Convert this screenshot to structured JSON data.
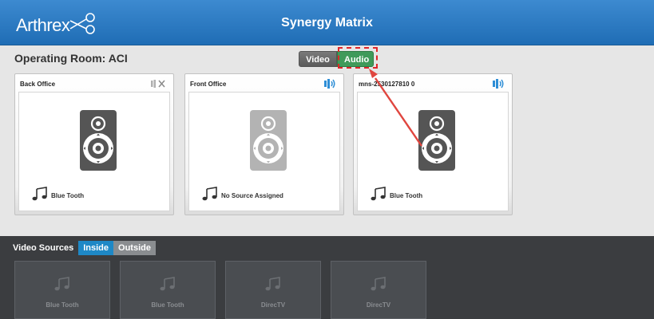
{
  "header": {
    "logo_text": "Arthrex",
    "app_title": "Synergy Matrix"
  },
  "room": {
    "title": "Operating Room: ACI"
  },
  "mode_toggle": {
    "video_label": "Video",
    "audio_label": "Audio",
    "selected": "Audio"
  },
  "zones": [
    {
      "name": "Back Office",
      "volume_icon": "speaker-muted-icon",
      "source": "Blue Tooth",
      "speaker_state": "active"
    },
    {
      "name": "Front Office",
      "volume_icon": "speaker-on-icon",
      "source": "No Source Assigned",
      "speaker_state": "inactive"
    },
    {
      "name": "mns-2530127810 0",
      "volume_icon": "speaker-on-icon",
      "source": "Blue Tooth",
      "speaker_state": "active"
    }
  ],
  "sources": {
    "title": "Video Sources",
    "tabs": [
      {
        "label": "Inside",
        "active": true
      },
      {
        "label": "Outside",
        "active": false
      }
    ],
    "tiles": [
      {
        "label": "Blue Tooth",
        "icon": "music-note-icon"
      },
      {
        "label": "Blue Tooth",
        "icon": "music-note-icon"
      },
      {
        "label": "DirecTV",
        "icon": "music-note-icon"
      },
      {
        "label": "DirecTV",
        "icon": "music-note-icon"
      }
    ]
  },
  "colors": {
    "header_blue": "#2a7cc7",
    "audio_green": "#3f9a5a",
    "inside_tab_blue": "#1e88c6",
    "highlight_red": "#e0252a",
    "speaker_dark": "#555555",
    "speaker_light": "#b3b3b3"
  }
}
